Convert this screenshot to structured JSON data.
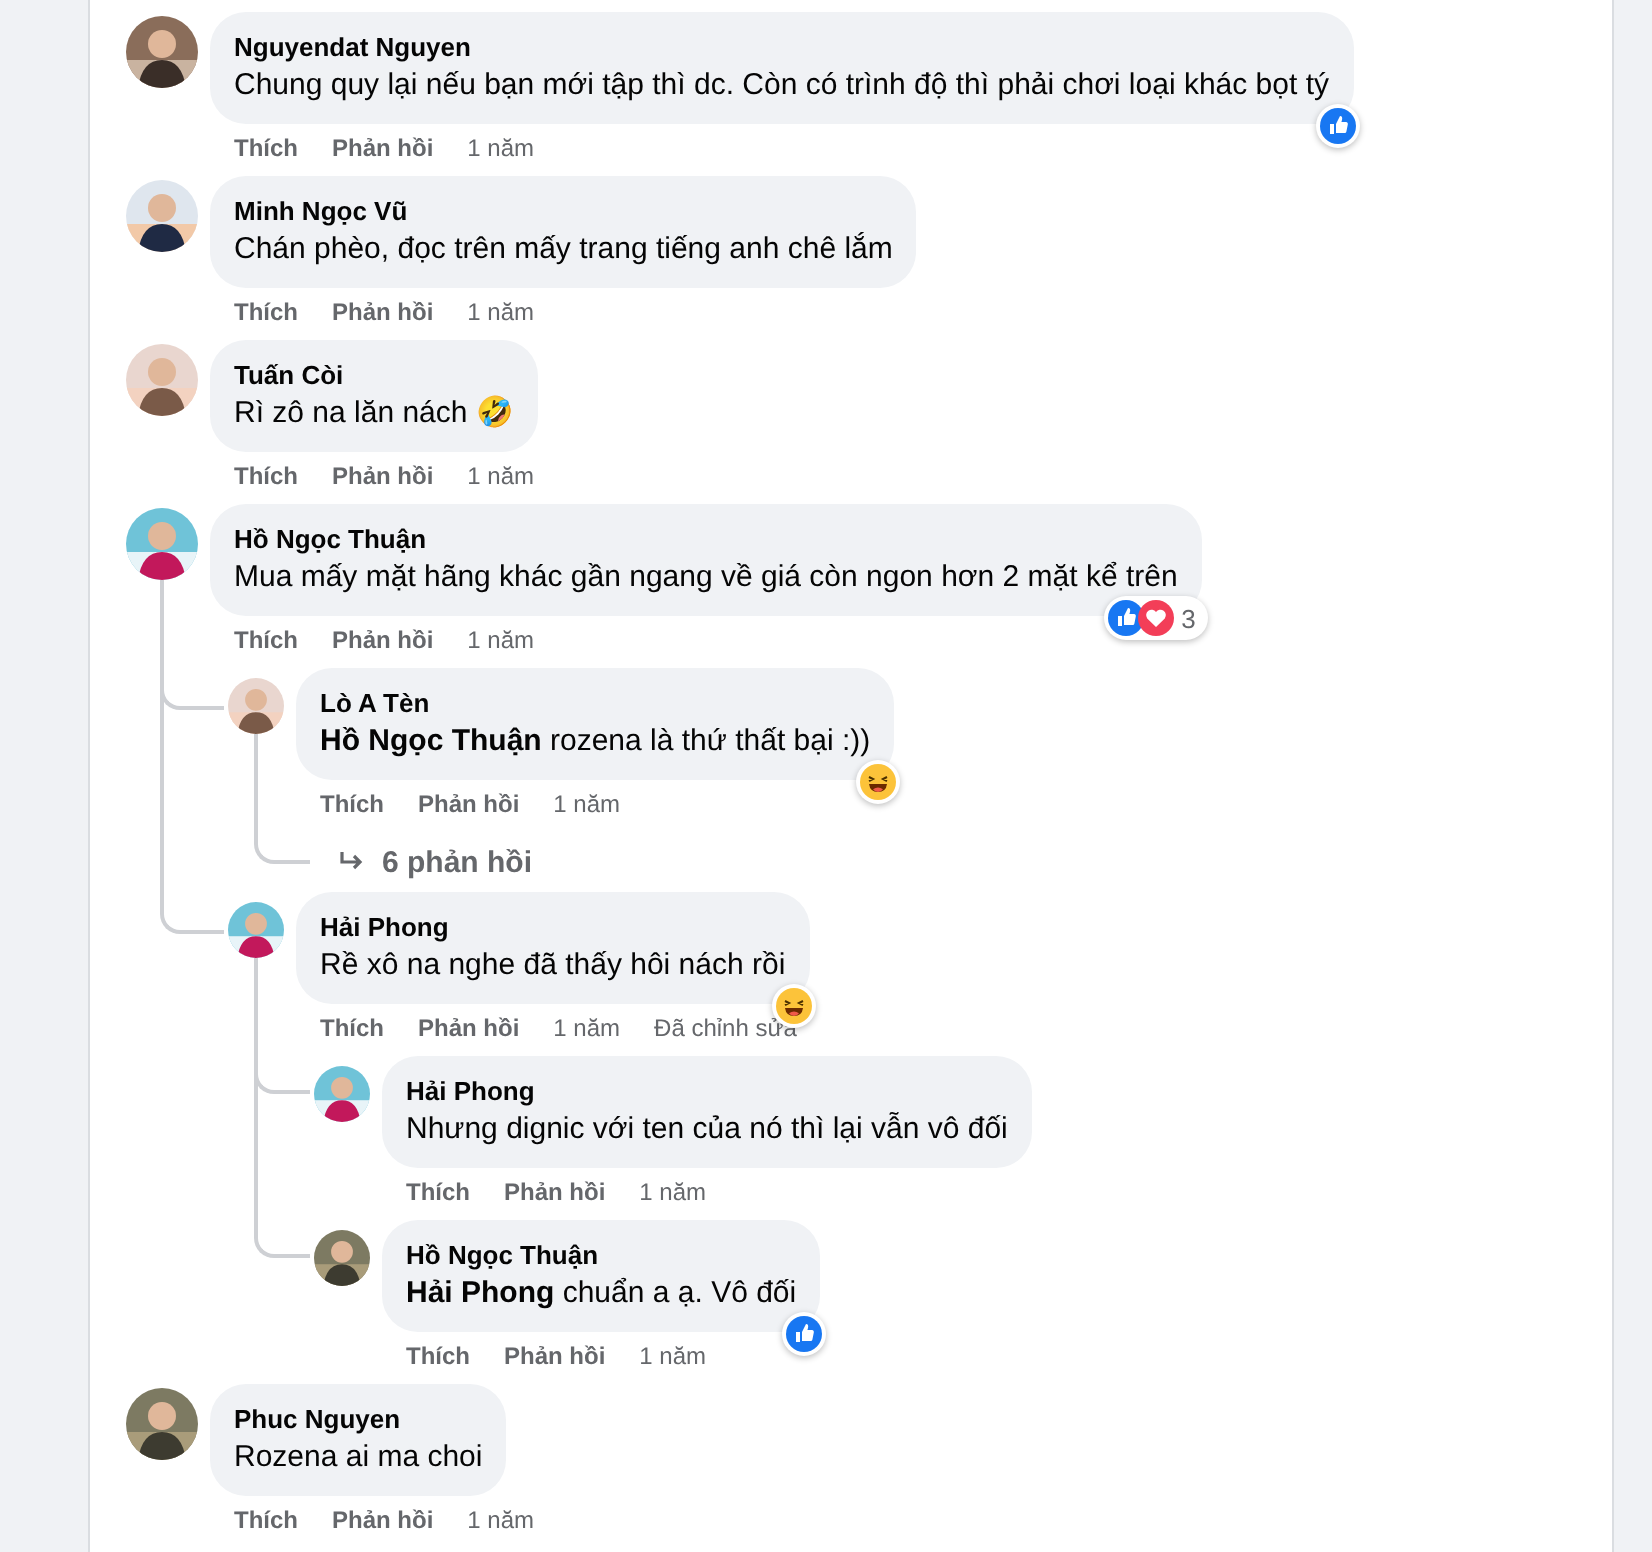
{
  "comments": [
    {
      "name": "Nguyendat Nguyen",
      "text": "Chung quy lại nếu bạn mới tập thì dc. Còn có trình độ thì phải chơi loại khác bọt tý",
      "reactions": [
        {
          "kind": "like"
        }
      ],
      "actions": [
        "Thích",
        "Phản hồi"
      ],
      "time": "1 năm"
    },
    {
      "name": "Minh Ngọc Vũ",
      "text": "Chán phèo, đọc trên mấy trang tiếng anh chê lắm",
      "actions": [
        "Thích",
        "Phản hồi"
      ],
      "time": "1 năm"
    },
    {
      "name": "Tuấn Còi",
      "text": "Rì zô na lăn nách 🤣",
      "actions": [
        "Thích",
        "Phản hồi"
      ],
      "time": "1 năm"
    },
    {
      "name": "Hồ Ngọc Thuận",
      "text": "Mua mấy mặt hãng khác gần ngang về giá còn ngon hơn 2 mặt kể trên",
      "reactions": [
        {
          "kind": "like"
        },
        {
          "kind": "love"
        }
      ],
      "reaction_count": "3",
      "actions": [
        "Thích",
        "Phản hồi"
      ],
      "time": "1 năm",
      "replies": [
        {
          "name": "Lò A Tèn",
          "text": "**Hồ Ngọc Thuận** rozena là thứ thất bại :))",
          "reactions": [
            {
              "kind": "haha"
            }
          ],
          "actions": [
            "Thích",
            "Phản hồi"
          ],
          "time": "1 năm",
          "more_replies": "6 phản hồi"
        },
        {
          "name": "Hải Phong",
          "text": "Rề xô na nghe đã thấy hôi nách rồi",
          "reactions": [
            {
              "kind": "haha"
            }
          ],
          "actions": [
            "Thích",
            "Phản hồi"
          ],
          "time": "1 năm",
          "edited": "Đã chỉnh sửa",
          "replies": [
            {
              "name": "Hải Phong",
              "text": "Nhưng dignic với ten của nó thì lại vẫn vô đối",
              "actions": [
                "Thích",
                "Phản hồi"
              ],
              "time": "1 năm"
            },
            {
              "name": "Hồ Ngọc Thuận",
              "text": "**Hải Phong** chuẩn a ạ. Vô đối",
              "reactions": [
                {
                  "kind": "like"
                }
              ],
              "actions": [
                "Thích",
                "Phản hồi"
              ],
              "time": "1 năm"
            }
          ]
        }
      ]
    },
    {
      "name": "Phuc Nguyen",
      "text": "Rozena ai ma choi",
      "actions": [
        "Thích",
        "Phản hồi"
      ],
      "time": "1 năm"
    }
  ]
}
